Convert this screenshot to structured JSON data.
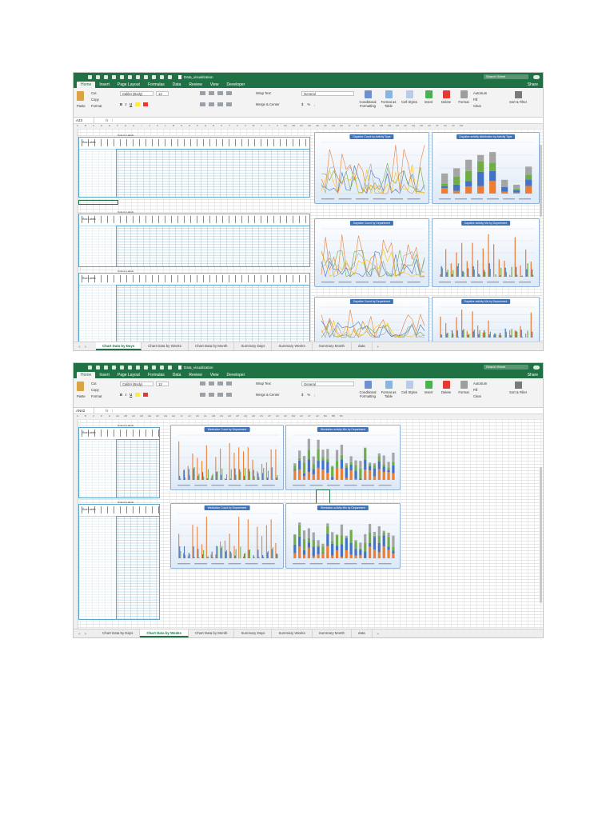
{
  "app": {
    "doc_title": "Data_visualization",
    "search_placeholder": "Search Sheet",
    "ribbon_tabs": [
      "Home",
      "Insert",
      "Page Layout",
      "Formulas",
      "Data",
      "Review",
      "View",
      "Developer"
    ],
    "share_label": "Share",
    "clipboard": {
      "paste": "Paste",
      "cut": "Cut",
      "copy": "Copy",
      "format": "Format"
    },
    "font_name": "Calibri (Body)",
    "font_size": "12",
    "font_buttons": [
      "B",
      "I",
      "U"
    ],
    "wrap_text": "Wrap Text",
    "merge_center": "Merge & Center",
    "number_format": "General",
    "number_buttons": [
      "$",
      "%",
      ","
    ],
    "conditional_formatting": "Conditional Formatting",
    "format_as_table": "Format as Table",
    "cell_styles": "Cell Styles",
    "insert": "Insert",
    "delete": "Delete",
    "format": "Format",
    "autosum": "AutoSum",
    "fill": "Fill",
    "clear": "Clear",
    "sort_filter": "Sort & Filter",
    "fx": "fx",
    "sheet_tabs": [
      "Chart Data by Days",
      "Chart Data by Weeks",
      "Chart Data by Month",
      "Summary Days",
      "Summary Weeks",
      "Summary Month",
      "data"
    ],
    "add_sheet": "+",
    "nav_arrows": [
      "<",
      ">"
    ],
    "col_letters_1": [
      "A",
      "B",
      "C",
      "D",
      "E",
      "F",
      "G",
      "H",
      "I",
      "J",
      "K",
      "L",
      "M",
      "N",
      "O",
      "P",
      "Q",
      "R",
      "S",
      "T",
      "U",
      "V",
      "W",
      "X",
      "Y",
      "Z",
      "AA",
      "AB",
      "AC",
      "AD",
      "AE",
      "AF",
      "AG",
      "AH",
      "AI",
      "AJ",
      "AK",
      "AL",
      "AM",
      "AN",
      "AO",
      "AP",
      "AQ",
      "AR",
      "AS",
      "AT",
      "AU",
      "AV",
      "AW"
    ],
    "col_letters_2": [
      "A",
      "B",
      "C",
      "D",
      "E",
      "AA",
      "AB",
      "AC",
      "AD",
      "AE",
      "AF",
      "AG",
      "AH",
      "AI",
      "AJ",
      "AK",
      "AL",
      "AM",
      "AN",
      "AO",
      "AP",
      "AQ",
      "AR",
      "AS",
      "AT",
      "AU",
      "AV",
      "AW",
      "AX",
      "AY",
      "AZ",
      "BA",
      "BB",
      "BC"
    ]
  },
  "screenshot1": {
    "name_box": "A23",
    "active_sheet": "Chart Data by Days",
    "tables": [
      {
        "caption": "Column Labels",
        "row_label": "Row Labels"
      },
      {
        "caption": "Column Labels",
        "row_label": "Row Labels"
      },
      {
        "caption": "Column Labels",
        "row_label": "Row Labels"
      }
    ],
    "charts": [
      {
        "title": "Dayalize Count by Activity Type",
        "kind": "line"
      },
      {
        "title": "Dayalize activity distribution by Activity Type",
        "kind": "stacked"
      },
      {
        "title": "Dayalize Count by Department",
        "kind": "line"
      },
      {
        "title": "Dayalize activity Mix by Department",
        "kind": "bar"
      },
      {
        "title": "Dayalize Count by Department",
        "kind": "line"
      },
      {
        "title": "Dayalize activity Mix by Department",
        "kind": "bar"
      }
    ]
  },
  "screenshot2": {
    "name_box": "AN42",
    "active_sheet": "Chart Data by Weeks",
    "tables": [
      {
        "caption": "Column Labels",
        "row_label": "Row Labels"
      },
      {
        "caption": "Column Labels",
        "row_label": "Row Labels"
      }
    ],
    "charts": [
      {
        "title": "Weekalize Count by Department",
        "kind": "bar"
      },
      {
        "title": "Weekalize activity Mix by Department",
        "kind": "stacked"
      },
      {
        "title": "Weekalize Count by Department",
        "kind": "bar"
      },
      {
        "title": "Weekalize activity Mix by Department",
        "kind": "stacked"
      }
    ]
  },
  "colors": {
    "excel_green": "#207245",
    "chart_title_bg": "#3f73b8",
    "series": [
      "#ed7d31",
      "#4472c4",
      "#70ad47",
      "#a5a5a5",
      "#ffc000",
      "#5b9bd5",
      "#9e480e",
      "#264478"
    ]
  }
}
